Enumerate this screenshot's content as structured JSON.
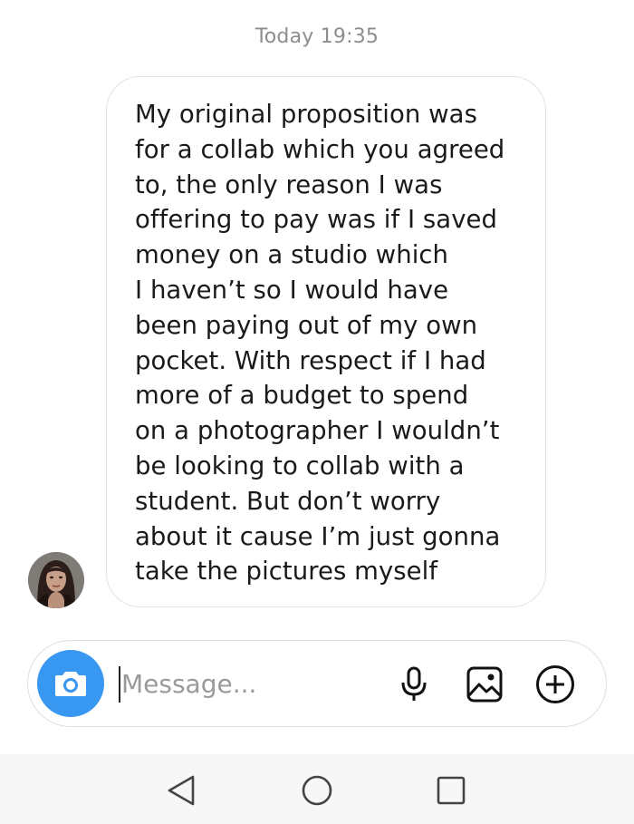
{
  "thread": {
    "timestamp": "Today 19:35"
  },
  "message": {
    "lines": [
      "My original proposition was",
      "for a collab which you agreed",
      "to, the only reason I was",
      "offering to pay was if I saved",
      "money on a studio which",
      "I haven’t so I would have",
      "been paying out of my own",
      "pocket. With respect if I had",
      "more of a budget to spend",
      "on a photographer I wouldn’t",
      "be looking to collab with a",
      "student. But don’t worry",
      "about it cause I’m just gonna",
      "take the pictures myself"
    ]
  },
  "composer": {
    "placeholder": "Message...",
    "value": "",
    "camera_icon": "camera-icon",
    "tools": [
      "microphone-icon",
      "gallery-icon",
      "plus-circle-icon"
    ],
    "accent_color": "#3897f0"
  },
  "navbar": {
    "buttons": [
      "back-triangle-icon",
      "home-circle-icon",
      "recents-square-icon"
    ]
  }
}
